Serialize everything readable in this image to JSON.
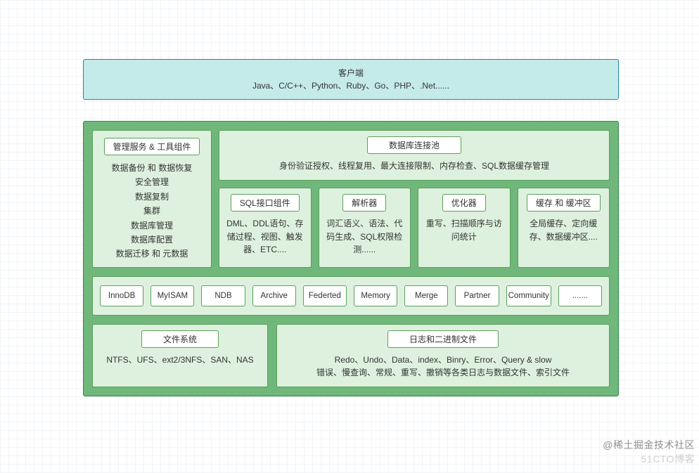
{
  "client": {
    "title": "客户端",
    "body": "Java、C/C++、Python、Ruby、Go、PHP、.Net......"
  },
  "server": {
    "mgmt": {
      "title": "管理服务 & 工具组件",
      "lines": [
        "数据备份 和 数据恢复",
        "安全管理",
        "数据复制",
        "集群",
        "数据库管理",
        "数据库配置",
        "数据迁移 和 元数据"
      ]
    },
    "pool": {
      "title": "数据库连接池",
      "body": "身份验证授权、线程复用、最大连接限制、内存检查、SQL数据缓存管理"
    },
    "components": [
      {
        "title": "SQL接口组件",
        "body": "DML、DDL语句、存储过程、视图、触发器、ETC...."
      },
      {
        "title": "解析器",
        "body": "词汇语义、语法、代码生成、SQL权限检测......"
      },
      {
        "title": "优化器",
        "body": "重写、扫描顺序与访问统计"
      },
      {
        "title": "缓存 和 缓冲区",
        "body": "全局缓存、定向缓存、数据缓冲区...."
      }
    ],
    "engines": [
      "InnoDB",
      "MyISAM",
      "NDB",
      "Archive",
      "Federted",
      "Memory",
      "Merge",
      "Partner",
      "Community",
      "......."
    ],
    "filesystem": {
      "title": "文件系统",
      "body": "NTFS、UFS、ext2/3NFS、SAN、NAS"
    },
    "logs": {
      "title": "日志和二进制文件",
      "line1": "Redo、Undo、Data、index、Binry、Error、Query & slow",
      "line2": "错误、慢查询、常规、重写、撤销等各类日志与数据文件、索引文件"
    }
  },
  "watermarks": {
    "w1": "@稀土掘金技术社区",
    "w2": "51CTO博客"
  }
}
